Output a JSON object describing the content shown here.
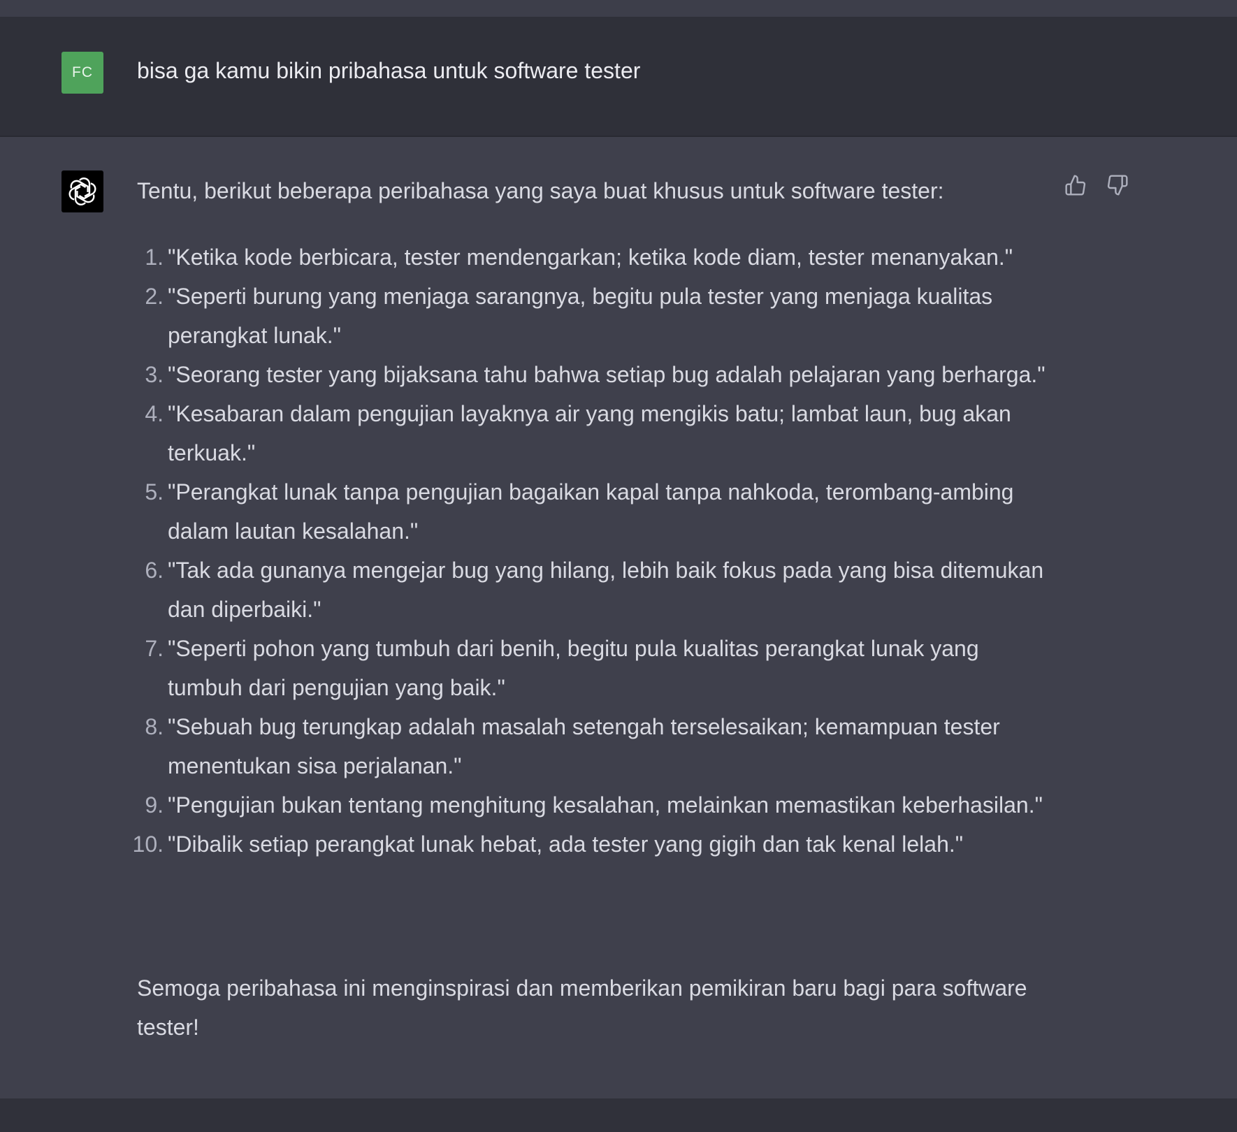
{
  "user_message": {
    "avatar_initials": "FC",
    "avatar_color": "#4fa35b",
    "text": "bisa ga kamu bikin pribahasa untuk software tester"
  },
  "assistant_message": {
    "avatar_icon": "openai-logo-icon",
    "intro": "Tentu, berikut beberapa peribahasa yang saya buat khusus untuk software tester:",
    "items": [
      {
        "num": "1.",
        "text": "\"Ketika kode berbicara, tester mendengarkan; ketika kode diam, tester menanyakan.\""
      },
      {
        "num": "2.",
        "text": "\"Seperti burung yang menjaga sarangnya, begitu pula tester yang menjaga kualitas perangkat lunak.\""
      },
      {
        "num": "3.",
        "text": "\"Seorang tester yang bijaksana tahu bahwa setiap bug adalah pelajaran yang berharga.\""
      },
      {
        "num": "4.",
        "text": "\"Kesabaran dalam pengujian layaknya air yang mengikis batu; lambat laun, bug akan terkuak.\""
      },
      {
        "num": "5.",
        "text": "\"Perangkat lunak tanpa pengujian bagaikan kapal tanpa nahkoda, terombang-ambing dalam lautan kesalahan.\""
      },
      {
        "num": "6.",
        "text": "\"Tak ada gunanya mengejar bug yang hilang, lebih baik fokus pada yang bisa ditemukan dan diperbaiki.\""
      },
      {
        "num": "7.",
        "text": "\"Seperti pohon yang tumbuh dari benih, begitu pula kualitas perangkat lunak yang tumbuh dari pengujian yang baik.\""
      },
      {
        "num": "8.",
        "text": "\"Sebuah bug terungkap adalah masalah setengah terselesaikan; kemampuan tester menentukan sisa perjalanan.\""
      },
      {
        "num": "9.",
        "text": "\"Pengujian bukan tentang menghitung kesalahan, melainkan memastikan keberhasilan.\""
      },
      {
        "num": "10.",
        "text": "\"Dibalik setiap perangkat lunak hebat, ada tester yang gigih dan tak kenal lelah.\""
      }
    ],
    "outro": "Semoga peribahasa ini menginspirasi dan memberikan pemikiran baru bagi para software tester!",
    "feedback": {
      "thumbs_up_icon": "thumbs-up-icon",
      "thumbs_down_icon": "thumbs-down-icon"
    }
  }
}
